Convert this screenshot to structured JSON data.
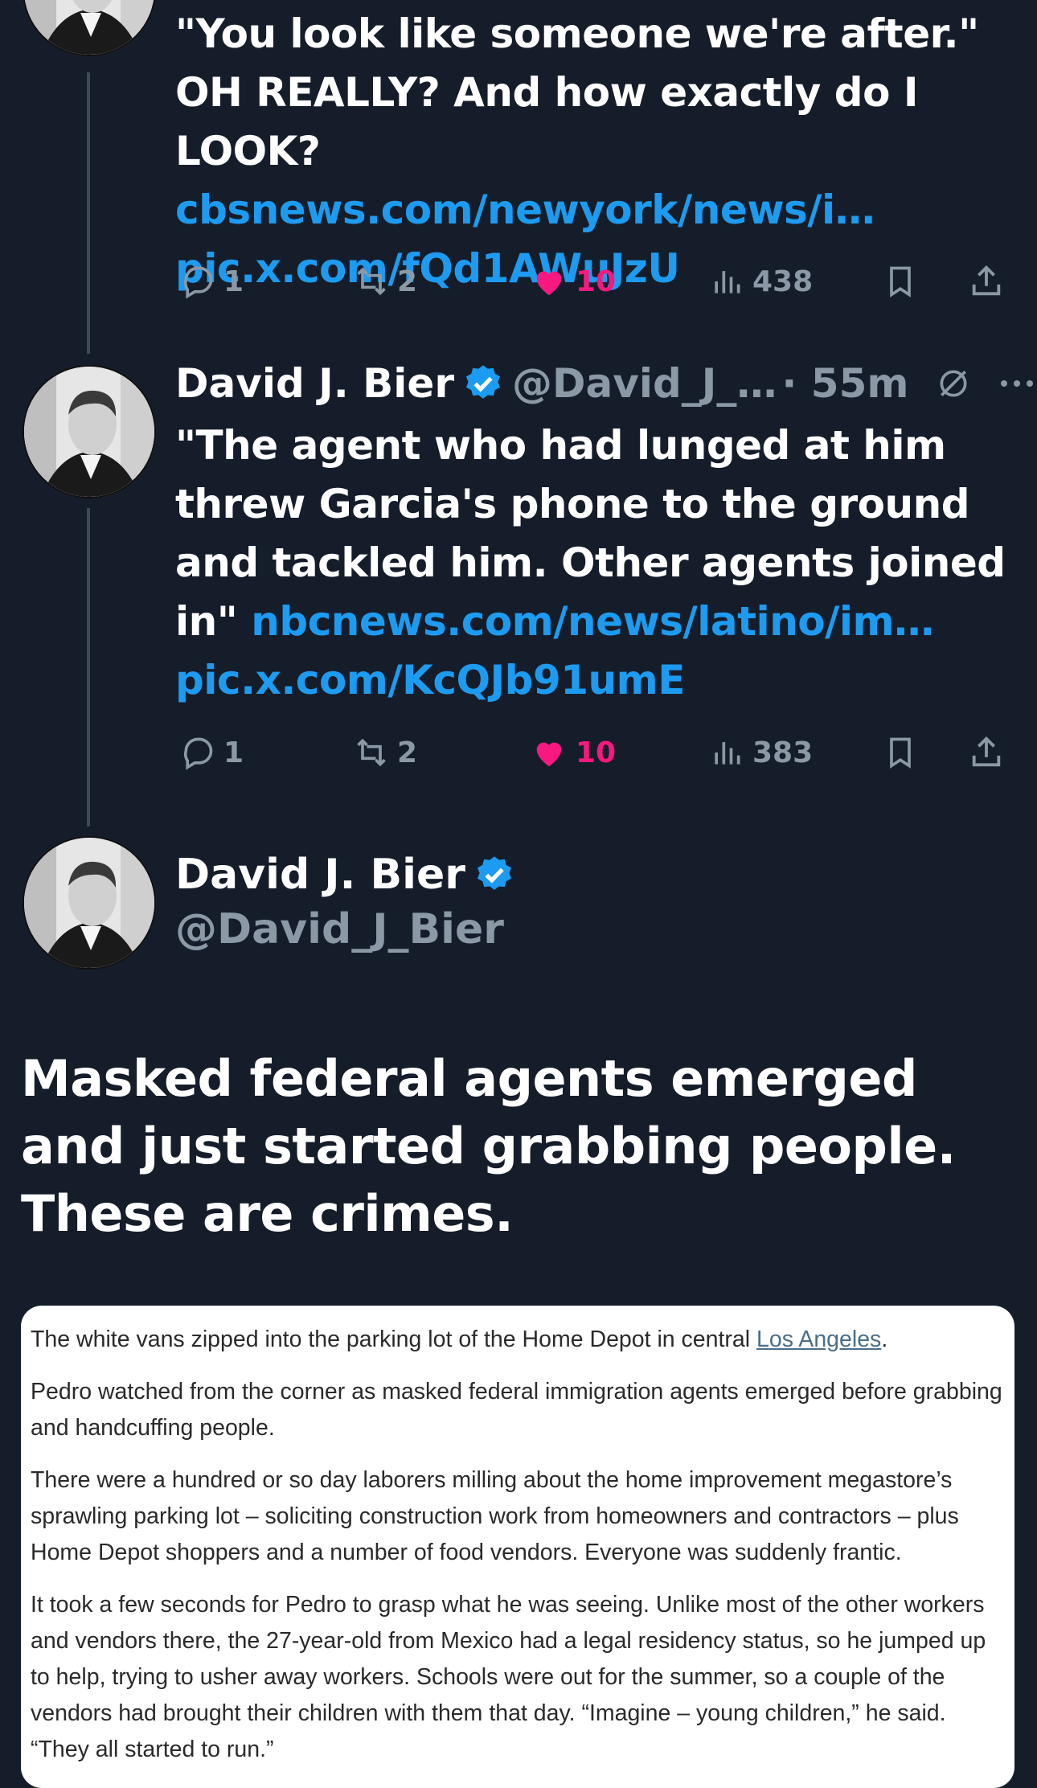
{
  "tweets": [
    {
      "text": "\"You look like someone we're after.\" OH REALLY? And how exactly do I LOOK?",
      "link": "cbsnews.com/newyork/news/i…",
      "media": "pic.x.com/fQd1AWuJzU",
      "replies": "1",
      "reposts": "2",
      "likes": "10",
      "views": "438"
    },
    {
      "name": "David J. Bier",
      "handle": "@David_J_…",
      "time": "· 55m",
      "text": "\"The agent who had lunged at him threw Garcia's phone to the ground and tackled him. Other agents joined in\"",
      "link": "nbcnews.com/news/latino/im…",
      "media": "pic.x.com/KcQJb91umE",
      "replies": "1",
      "reposts": "2",
      "likes": "10",
      "views": "383"
    }
  ],
  "main": {
    "name": "David J. Bier",
    "handle": "@David_J_Bier",
    "text": "Masked federal agents emerged and just started grabbing people. These are crimes."
  },
  "article": {
    "p1_before": "The white vans zipped into the parking lot of the Home Depot in central ",
    "p1_link": "Los Angeles",
    "p1_after": ".",
    "p2": "Pedro watched from the corner as masked federal immigration agents emerged before grabbing and handcuffing people.",
    "p3": "There were a hundred or so day laborers milling about the home improvement megastore’s sprawling parking lot – soliciting construction work from homeowners and contractors – plus Home Depot shoppers and a number of food vendors. Everyone was suddenly frantic.",
    "p4": "It took a few seconds for Pedro to grasp what he was seeing. Unlike most of the other workers and vendors there, the 27-year-old from Mexico had a legal residency status, so he jumped up to help, trying to usher away workers. Schools were out for the summer, so a couple of the vendors had brought their children with them that day. “Imagine – young children,” he said. “They all started to run.”"
  },
  "colors": {
    "background": "#151d2a",
    "link": "#1d9bf0",
    "like": "#f91880",
    "muted": "#8b98a5",
    "verified": "#1d9bf0"
  }
}
